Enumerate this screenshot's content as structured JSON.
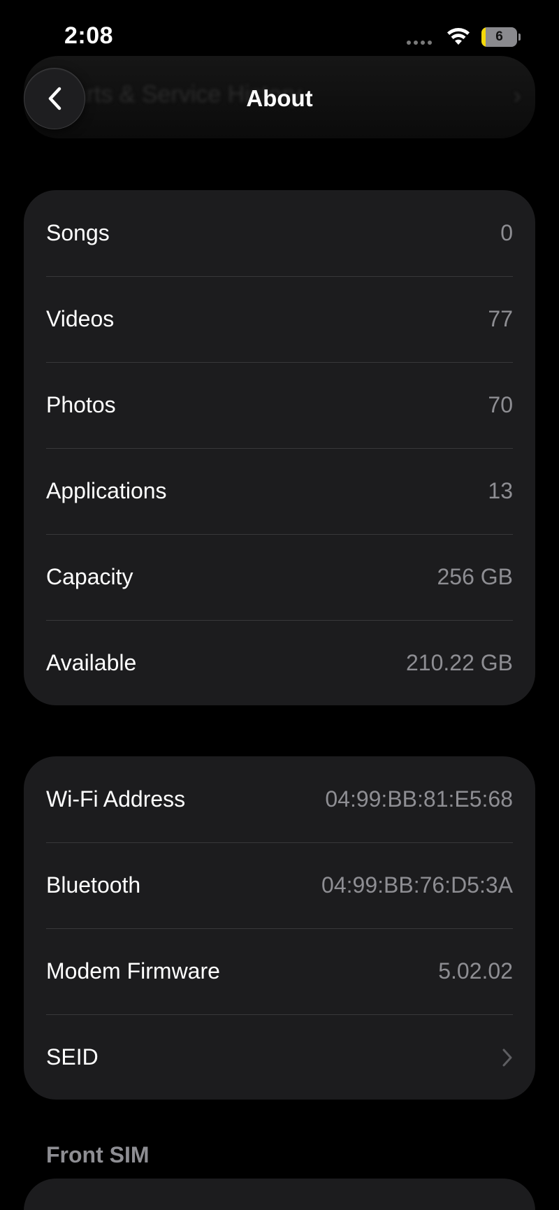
{
  "status_bar": {
    "time": "2:08",
    "battery_level": "6",
    "battery_fraction": 0.06,
    "accent_color": "#f5d90a"
  },
  "nav": {
    "title": "About",
    "previous_title": "Parts & Service History",
    "back_icon": "chevron-left-icon"
  },
  "media_group": [
    {
      "label": "Songs",
      "value": "0"
    },
    {
      "label": "Videos",
      "value": "77"
    },
    {
      "label": "Photos",
      "value": "70"
    },
    {
      "label": "Applications",
      "value": "13"
    },
    {
      "label": "Capacity",
      "value": "256 GB"
    },
    {
      "label": "Available",
      "value": "210.22 GB"
    }
  ],
  "network_group": [
    {
      "label": "Wi-Fi Address",
      "value": "04:99:BB:81:E5:68"
    },
    {
      "label": "Bluetooth",
      "value": "04:99:BB:76:D5:3A"
    },
    {
      "label": "Modem Firmware",
      "value": "5.02.02"
    },
    {
      "label": "SEID",
      "icon": "chevron-right-icon"
    }
  ],
  "front_sim": {
    "header": "Front SIM"
  }
}
